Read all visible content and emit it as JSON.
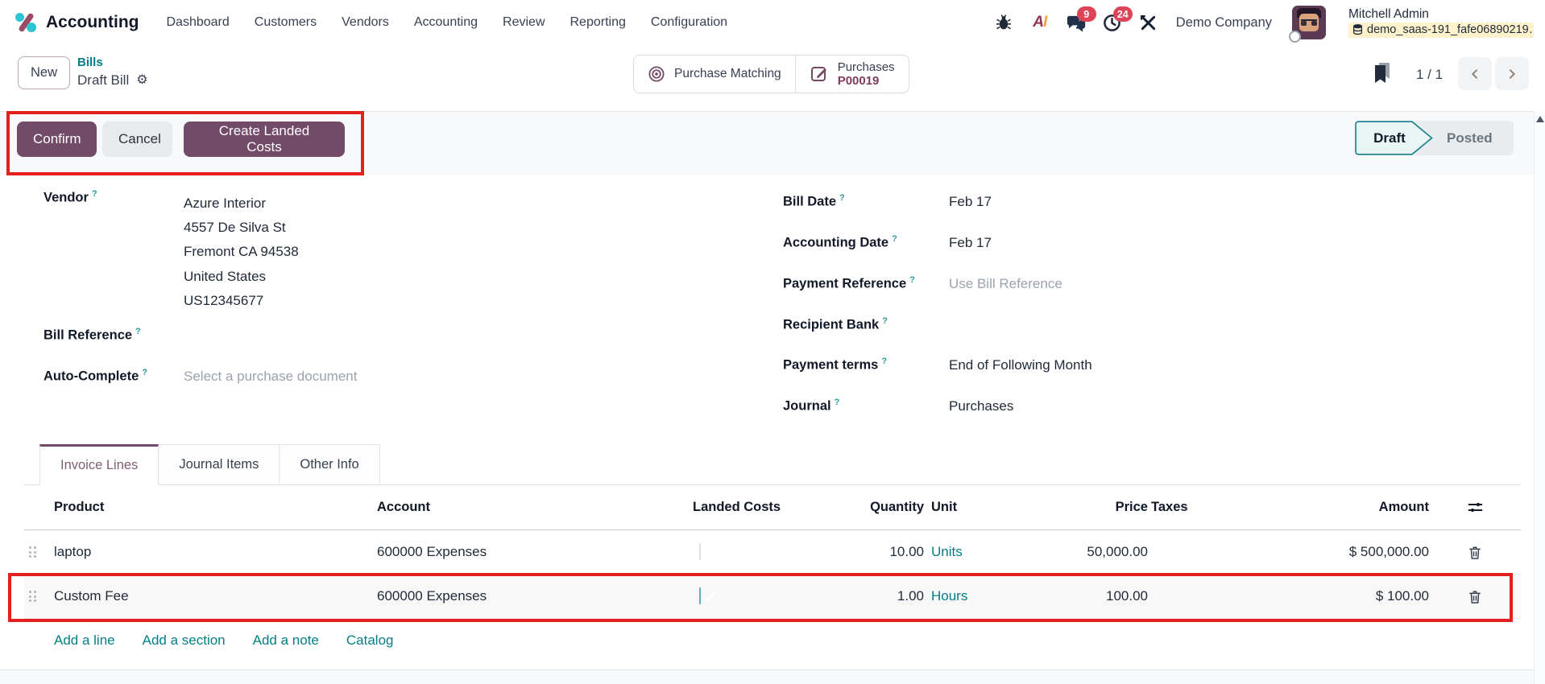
{
  "app": {
    "title": "Accounting"
  },
  "help_marker": "?",
  "nav": {
    "items": [
      "Dashboard",
      "Customers",
      "Vendors",
      "Accounting",
      "Review",
      "Reporting",
      "Configuration"
    ]
  },
  "systray": {
    "ai_a": "A",
    "ai_i": "I",
    "messages_badge": "9",
    "activities_badge": "24",
    "company": "Demo Company",
    "user_name": "Mitchell Admin",
    "database": "demo_saas-191_fafe06890219…"
  },
  "control_panel": {
    "new_button": "New",
    "breadcrumb_parent": "Bills",
    "breadcrumb_current": "Draft Bill",
    "pager": "1 / 1"
  },
  "smart_buttons": {
    "purchase_matching": "Purchase Matching",
    "purchases_label": "Purchases",
    "purchases_ref": "P00019"
  },
  "actions": {
    "confirm": "Confirm",
    "cancel": "Cancel",
    "create_landed_costs": "Create Landed Costs"
  },
  "statusbar": {
    "draft": "Draft",
    "posted": "Posted",
    "active": "Draft"
  },
  "form": {
    "vendor": {
      "label": "Vendor",
      "name": "Azure Interior",
      "street": "4557 De Silva St",
      "city": "Fremont CA 94538",
      "country": "United States",
      "vat": "US12345677"
    },
    "bill_reference": {
      "label": "Bill Reference",
      "value": ""
    },
    "auto_complete": {
      "label": "Auto-Complete",
      "placeholder": "Select a purchase document"
    },
    "bill_date": {
      "label": "Bill Date",
      "value": "Feb 17"
    },
    "accounting_date": {
      "label": "Accounting Date",
      "value": "Feb 17"
    },
    "payment_reference": {
      "label": "Payment Reference",
      "placeholder": "Use Bill Reference"
    },
    "recipient_bank": {
      "label": "Recipient Bank",
      "value": ""
    },
    "payment_terms": {
      "label": "Payment terms",
      "value": "End of Following Month"
    },
    "journal": {
      "label": "Journal",
      "value": "Purchases"
    }
  },
  "tabs": {
    "invoice_lines": "Invoice Lines",
    "journal_items": "Journal Items",
    "other_info": "Other Info",
    "active": "Invoice Lines"
  },
  "invoice_table": {
    "columns": {
      "product": "Product",
      "account": "Account",
      "landed_costs": "Landed Costs",
      "quantity": "Quantity",
      "unit": "Unit",
      "price": "Price",
      "taxes": "Taxes",
      "amount": "Amount"
    },
    "rows": [
      {
        "product": "laptop",
        "account": "600000 Expenses",
        "landed_costs": false,
        "quantity": "10.00",
        "unit": "Units",
        "price": "50,000.00",
        "taxes": "",
        "amount": "$ 500,000.00"
      },
      {
        "product": "Custom Fee",
        "account": "600000 Expenses",
        "landed_costs": true,
        "quantity": "1.00",
        "unit": "Hours",
        "price": "100.00",
        "taxes": "",
        "amount": "$ 100.00"
      }
    ],
    "footer_links": [
      "Add a line",
      "Add a section",
      "Add a note",
      "Catalog"
    ]
  },
  "colors": {
    "primary": "#714B67",
    "link": "#017E84",
    "annotation": "#E2201C",
    "checkbox_checked": "#5BB0C2"
  }
}
